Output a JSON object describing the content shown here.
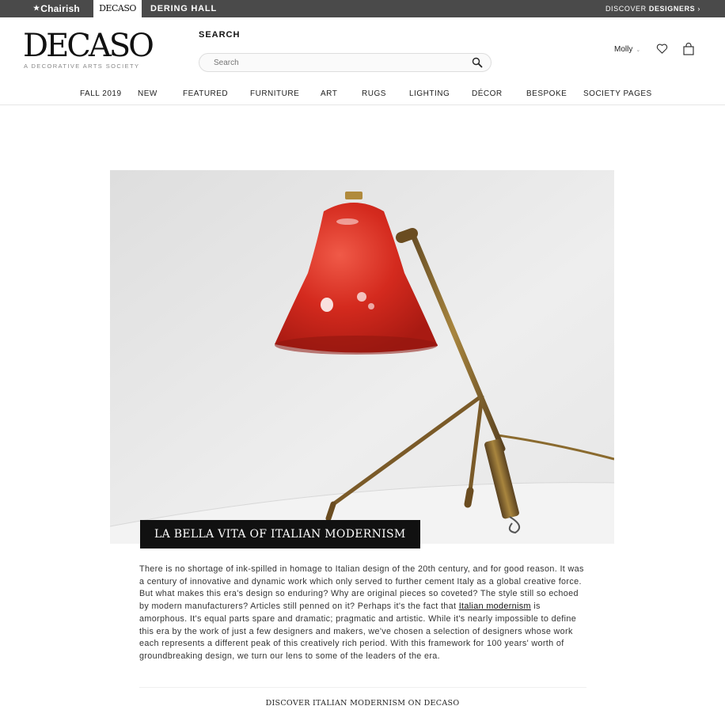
{
  "topbar": {
    "chairish": "Chairish",
    "decaso": "DECASO",
    "dering_hall": "DERING HALL",
    "discover_prefix": "DISCOVER",
    "discover_strong": "DESIGNERS",
    "discover_arrow": "›"
  },
  "header": {
    "logo": "DECASO",
    "tagline": "A DECORATIVE ARTS SOCIETY",
    "search_label": "SEARCH",
    "search_placeholder": "Search",
    "user_name": "Molly",
    "user_caret": "⌄"
  },
  "nav": {
    "items": [
      "FALL 2019",
      "NEW",
      "FEATURED",
      "FURNITURE",
      "ART",
      "RUGS",
      "LIGHTING",
      "DÉCOR",
      "BESPOKE",
      "SOCIETY PAGES"
    ]
  },
  "hero": {
    "title": "LA BELLA VITA OF ITALIAN MODERNISM"
  },
  "article": {
    "text_before_link": "There is no shortage of ink-spilled in homage to Italian design of the 20th century, and for good reason. It was a century of innovative and dynamic work which only served to further cement Italy as a global creative force. But what makes this era's design so enduring? Why are original pieces so coveted? The style still so echoed by modern manufacturers? Articles still penned on it? Perhaps it's the fact that ",
    "link_text": "Italian modernism",
    "text_after_link": " is amorphous. It's equal parts spare and dramatic; pragmatic and artistic. While it's nearly impossible to define this era by the work of just a few designers and makers, we've chosen a selection of designers whose work each represents a different peak of this creatively rich period. With this framework for 100 years' worth of groundbreaking design, we turn our lens to some of the leaders of the era."
  },
  "cta": "DISCOVER ITALIAN MODERNISM ON DECASO",
  "colors": {
    "topbar_bg": "#4a4a4a",
    "lamp_red": "#d42a1e",
    "brass": "#8a6a2e"
  }
}
